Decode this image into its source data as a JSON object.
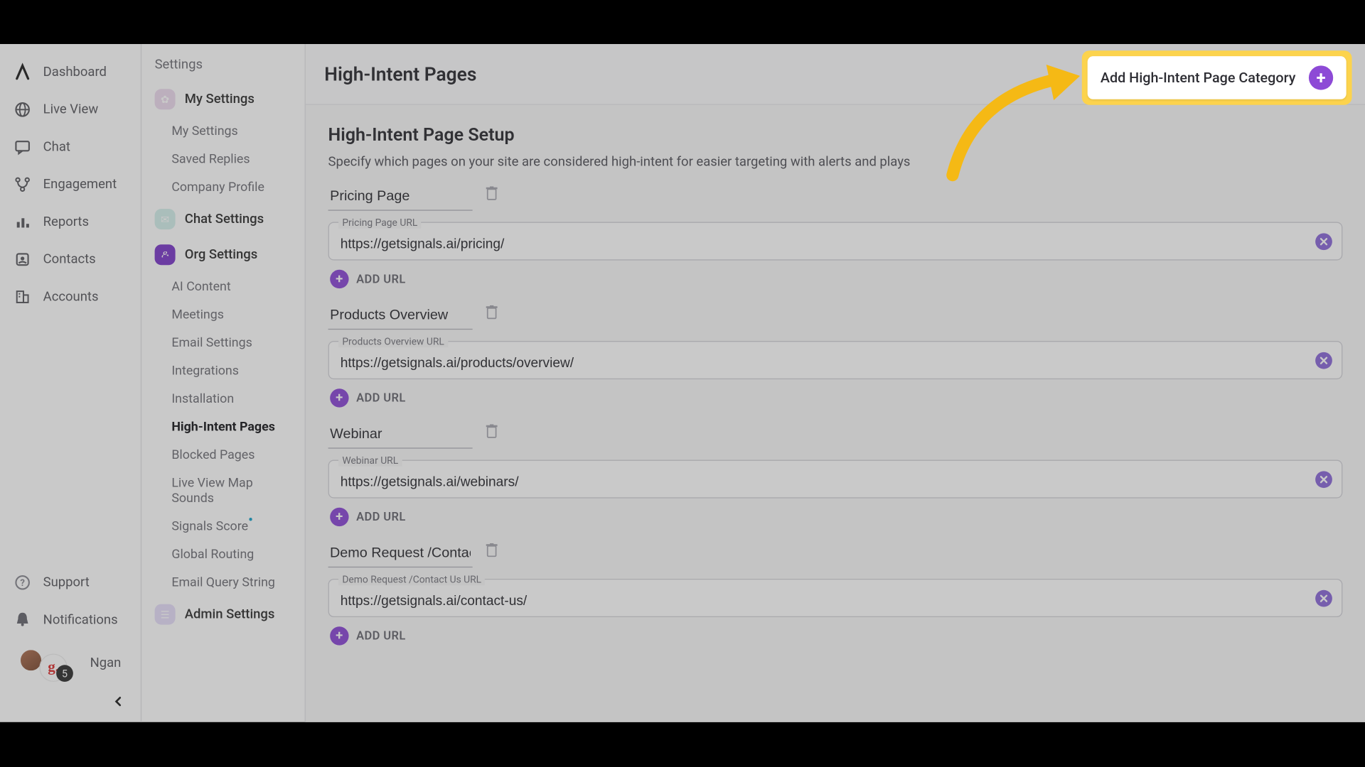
{
  "leftnav": {
    "items": [
      {
        "label": "Dashboard"
      },
      {
        "label": "Live View"
      },
      {
        "label": "Chat"
      },
      {
        "label": "Engagement"
      },
      {
        "label": "Reports"
      },
      {
        "label": "Contacts"
      },
      {
        "label": "Accounts"
      }
    ],
    "support": "Support",
    "notifications": "Notifications",
    "user_name": "Ngan",
    "avatar_initial": "g.",
    "notif_count": "5"
  },
  "settingsnav": {
    "heading": "Settings",
    "sections": {
      "my": "My Settings",
      "chat": "Chat Settings",
      "org": "Org Settings",
      "admin": "Admin Settings"
    },
    "my_subs": [
      "My Settings",
      "Saved Replies",
      "Company Profile"
    ],
    "org_subs": [
      "AI Content",
      "Meetings",
      "Email Settings",
      "Integrations",
      "Installation",
      "High-Intent Pages",
      "Blocked Pages",
      "Live View Map Sounds",
      "Signals Score",
      "Global Routing",
      "Email Query String"
    ]
  },
  "page": {
    "title": "High-Intent Pages",
    "setup_heading": "High-Intent Page Setup",
    "setup_desc": "Specify which pages on your site are considered high-intent for easier targeting with alerts and plays",
    "add_url": "ADD URL",
    "cta": "Add High-Intent Page Category"
  },
  "categories": [
    {
      "name": "Pricing Page",
      "url_label": "Pricing Page URL",
      "url": "https://getsignals.ai/pricing/"
    },
    {
      "name": "Products Overview",
      "url_label": "Products Overview URL",
      "url": "https://getsignals.ai/products/overview/"
    },
    {
      "name": "Webinar",
      "url_label": "Webinar URL",
      "url": "https://getsignals.ai/webinars/"
    },
    {
      "name": "Demo Request /Contact Us",
      "url_label": "Demo Request /Contact Us URL",
      "url": "https://getsignals.ai/contact-us/"
    }
  ]
}
